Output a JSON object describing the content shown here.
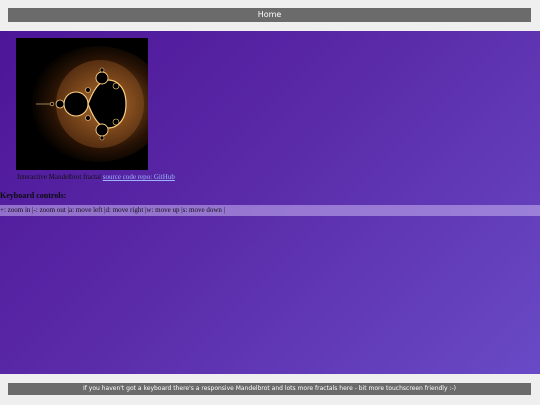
{
  "header": {
    "home_label": "Home"
  },
  "fractal": {
    "image_name": "mandelbrot-fractal-image"
  },
  "caption": {
    "text": "Interactive Mandelbrot fractal",
    "link_label": "source code repo: GitHub"
  },
  "keyboard": {
    "title": "Keyboard controls:",
    "controls": "+: zoom in |-: zoom out |a: move left |d: move right |w: move up |s: move down |"
  },
  "footer": {
    "text": "If you haven't got a keyboard there's a responsive Mandelbrot and lots more fractals here - bit more touchscreen friendly :-)"
  },
  "colors": {
    "background_top": "#4c1396",
    "background_bottom": "#6a4cc8",
    "bar": "#6b6b6b",
    "bar_text": "#ffffff",
    "link": "#9db4ff"
  }
}
